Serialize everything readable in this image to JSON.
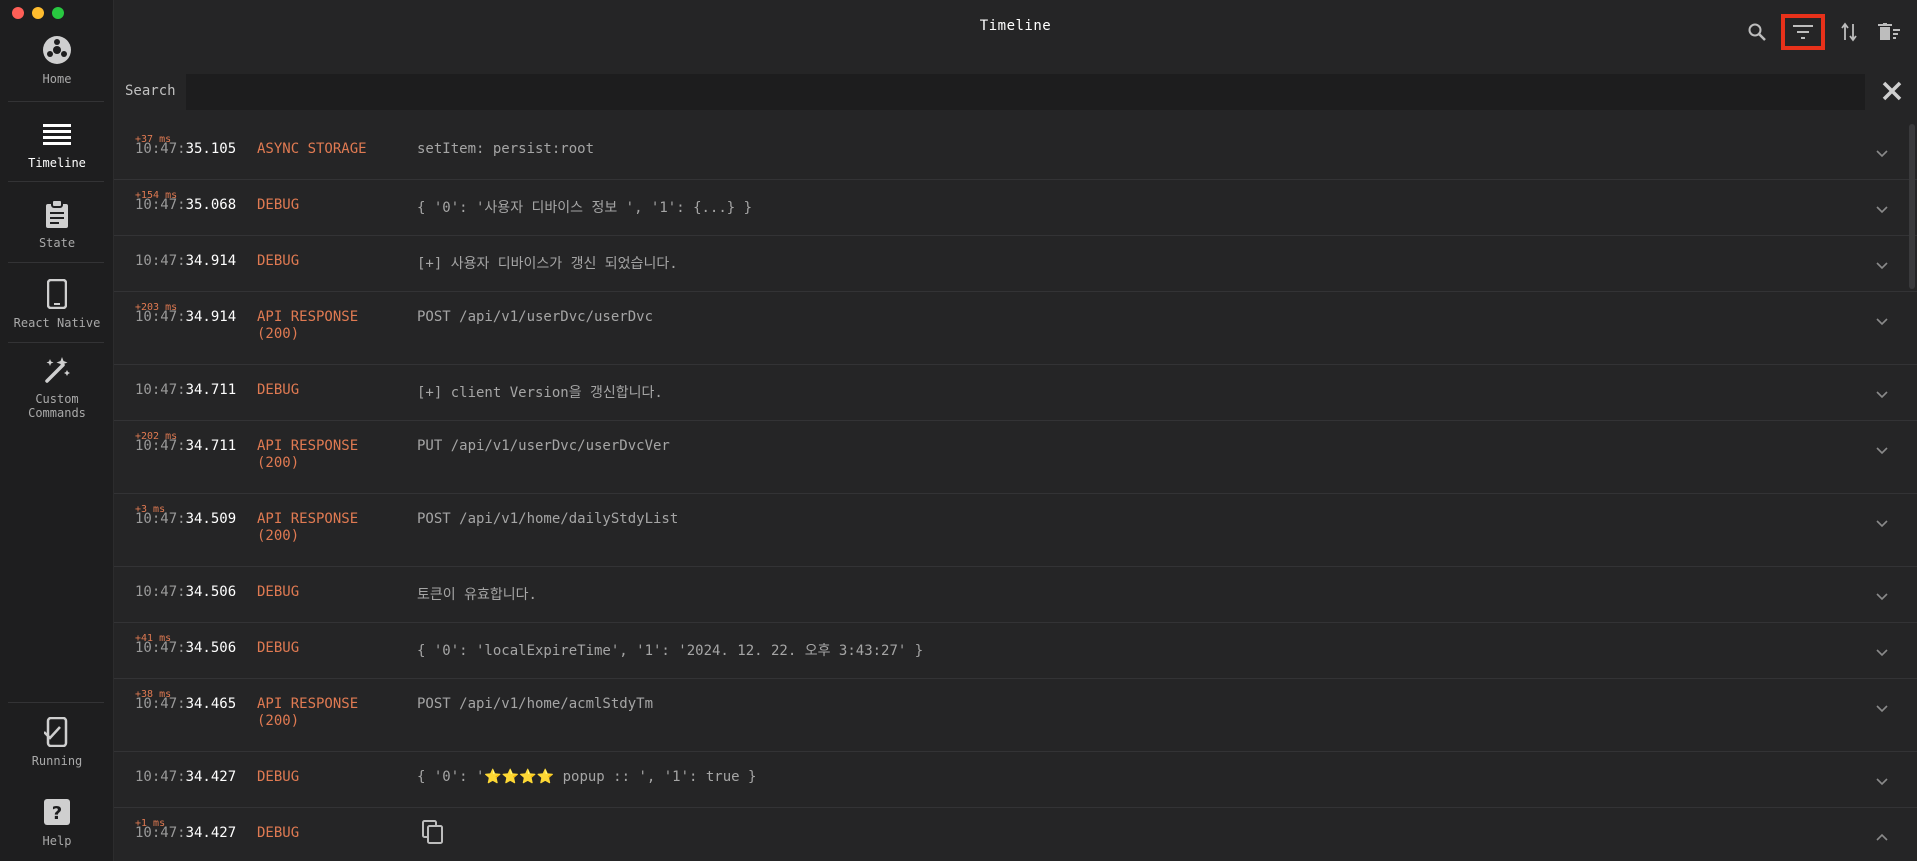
{
  "window": {
    "title": "Timeline"
  },
  "sidebar": {
    "items": [
      {
        "label": "Home",
        "icon": "home-icon"
      },
      {
        "label": "Timeline",
        "icon": "timeline-icon",
        "active": true
      },
      {
        "label": "State",
        "icon": "clipboard-icon"
      },
      {
        "label": "React Native",
        "icon": "phone-icon"
      },
      {
        "label": "Custom\nCommands",
        "icon": "magic-wand-icon"
      }
    ],
    "bottom_items": [
      {
        "label": "Running",
        "icon": "phone-check-icon"
      },
      {
        "label": "Help",
        "icon": "help-icon"
      }
    ]
  },
  "header": {
    "actions": [
      "search-icon",
      "filter-icon",
      "sort-icon",
      "clear-icon"
    ],
    "highlighted_action": "filter-icon",
    "highlight_color": "#e8311a"
  },
  "search": {
    "label": "Search",
    "value": "",
    "placeholder": ""
  },
  "colors": {
    "accent": "#e07a52",
    "background": "#252526",
    "sidebar": "#1e1e1f"
  },
  "timeline": [
    {
      "delta": "+37 ms",
      "time_prefix": "10:47:",
      "time_main": "35.105",
      "type": "ASYNC STORAGE",
      "message": "setItem: persist:root",
      "expanded": false
    },
    {
      "delta": "+154 ms",
      "time_prefix": "10:47:",
      "time_main": "35.068",
      "type": "DEBUG",
      "message": "{ '0': '사용자 디바이스 정보 ', '1': {...} }",
      "expanded": false
    },
    {
      "delta": "",
      "time_prefix": "10:47:",
      "time_main": "34.914",
      "type": "DEBUG",
      "message": "[+] 사용자 디바이스가 갱신 되었습니다.",
      "expanded": false
    },
    {
      "delta": "+203 ms",
      "time_prefix": "10:47:",
      "time_main": "34.914",
      "type": "API RESPONSE\n(200)",
      "message": "POST /api/v1/userDvc/userDvc",
      "expanded": false
    },
    {
      "delta": "",
      "time_prefix": "10:47:",
      "time_main": "34.711",
      "type": "DEBUG",
      "message": "[+] client Version을 갱신합니다.",
      "expanded": false
    },
    {
      "delta": "+202 ms",
      "time_prefix": "10:47:",
      "time_main": "34.711",
      "type": "API RESPONSE\n(200)",
      "message": "PUT /api/v1/userDvc/userDvcVer",
      "expanded": false
    },
    {
      "delta": "+3 ms",
      "time_prefix": "10:47:",
      "time_main": "34.509",
      "type": "API RESPONSE\n(200)",
      "message": "POST /api/v1/home/dailyStdyList",
      "expanded": false
    },
    {
      "delta": "",
      "time_prefix": "10:47:",
      "time_main": "34.506",
      "type": "DEBUG",
      "message": "토큰이 유효합니다.",
      "expanded": false
    },
    {
      "delta": "+41 ms",
      "time_prefix": "10:47:",
      "time_main": "34.506",
      "type": "DEBUG",
      "message": "{ '0': 'localExpireTime', '1': '2024. 12. 22. 오후 3:43:27' }",
      "expanded": false
    },
    {
      "delta": "+38 ms",
      "time_prefix": "10:47:",
      "time_main": "34.465",
      "type": "API RESPONSE\n(200)",
      "message": "POST /api/v1/home/acmlStdyTm",
      "expanded": false
    },
    {
      "delta": "",
      "time_prefix": "10:47:",
      "time_main": "34.427",
      "type": "DEBUG",
      "message": "{ '0': '⭐⭐⭐⭐ popup :: ', '1': true }",
      "expanded": false
    },
    {
      "delta": "+1 ms",
      "time_prefix": "10:47:",
      "time_main": "34.427",
      "type": "DEBUG",
      "message": "",
      "expanded": true,
      "message_icon": "copy-icon"
    }
  ]
}
